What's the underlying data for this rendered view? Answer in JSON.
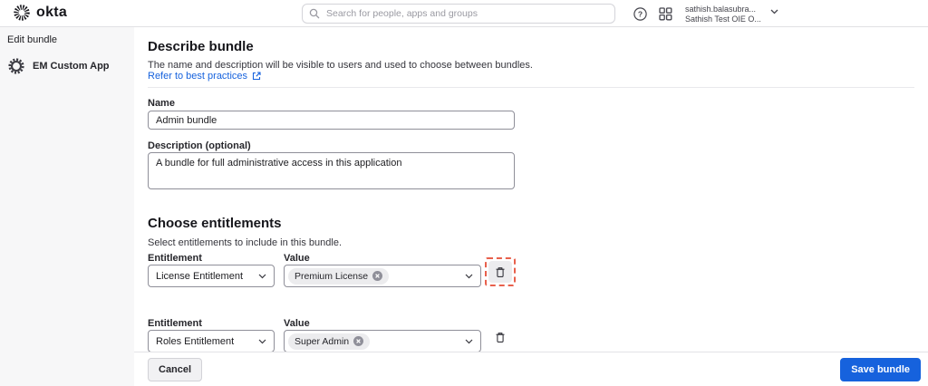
{
  "header": {
    "logo_text": "okta",
    "search": {
      "placeholder": "Search for people, apps and groups"
    },
    "user": {
      "line1": "sathish.balasubra...",
      "line2": "Sathish Test OIE O..."
    }
  },
  "sidebar": {
    "title": "Edit bundle",
    "app_name": "EM Custom App"
  },
  "main": {
    "describe": {
      "title": "Describe bundle",
      "subtitle": "The name and description will be visible to users and used to choose between bundles.",
      "link_label": "Refer to best practices"
    },
    "name_field": {
      "label": "Name",
      "value": "Admin bundle"
    },
    "description_field": {
      "label": "Description (optional)",
      "value": "A bundle for full administrative access in this application"
    },
    "entitlements": {
      "title": "Choose entitlements",
      "subtitle": "Select entitlements to include in this bundle.",
      "rows": [
        {
          "entitlement_label": "Entitlement",
          "value_label": "Value",
          "entitlement": "License Entitlement",
          "value_chip": "Premium License",
          "highlighted": true
        },
        {
          "entitlement_label": "Entitlement",
          "value_label": "Value",
          "entitlement": "Roles Entitlement",
          "value_chip": "Super Admin",
          "highlighted": false
        }
      ]
    }
  },
  "footer": {
    "cancel_label": "Cancel",
    "save_label": "Save bundle"
  },
  "colors": {
    "accent_blue": "#1662dd",
    "highlight_dashed": "#e8604c",
    "sidebar_bg": "#f7f7f8",
    "chip_bg": "#ececee"
  }
}
